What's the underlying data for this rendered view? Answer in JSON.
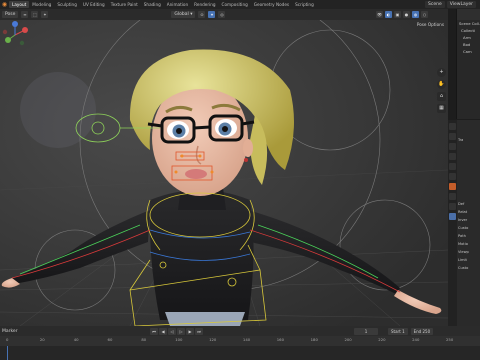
{
  "topbar": {
    "tabs": [
      "Layout",
      "Modeling",
      "Sculpting",
      "UV Editing",
      "Texture Paint",
      "Shading",
      "Animation",
      "Rendering",
      "Compositing",
      "Geometry Nodes",
      "Scripting"
    ],
    "active_tab": "Layout",
    "scene_label": "Scene",
    "view_layer_label": "ViewLayer"
  },
  "viewport_header": {
    "mode": "Pose",
    "orientation": "Global",
    "pose_options": "Pose Options"
  },
  "outliner": {
    "rows": [
      "Scene Coll.",
      "Collecti",
      "Arm",
      "Bod",
      "Cam"
    ]
  },
  "properties": {
    "rows": [
      "",
      "",
      "Tra",
      "",
      "",
      "",
      "",
      "",
      "",
      "",
      "Def",
      "Relat",
      "Inver",
      "Custo",
      "Path",
      "Motio",
      "Viewp",
      "Limit",
      "Custo"
    ]
  },
  "timeline": {
    "label": "Marker",
    "current_frame": "1",
    "start_label": "Start",
    "start_value": "1",
    "end_label": "End",
    "end_value": "250",
    "ruler_ticks": [
      "0",
      "20",
      "40",
      "60",
      "80",
      "100",
      "120",
      "140",
      "160",
      "180",
      "200",
      "220",
      "240",
      "250"
    ]
  }
}
